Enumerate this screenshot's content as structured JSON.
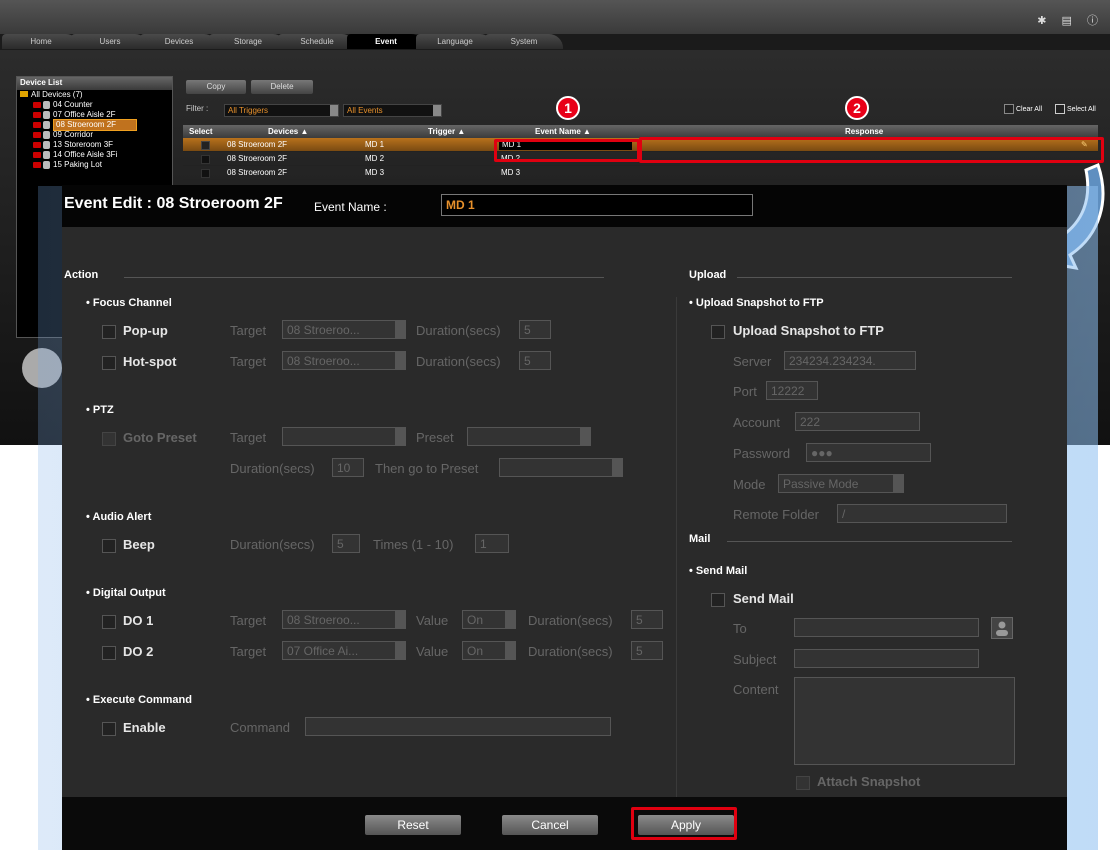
{
  "tabs": [
    "Home",
    "Users",
    "Devices",
    "Storage",
    "Schedule",
    "Event",
    "Language",
    "System"
  ],
  "active_tab": "Event",
  "device_list": {
    "title": "Device List",
    "root": "All Devices (7)",
    "items": [
      "04  Counter",
      "07  Office Aisle 2F",
      "08  Stroeroom 2F",
      "09  Corridor",
      "13  Storeroom 3F",
      "14  Office Aisle 3Fi",
      "15  Paking Lot"
    ]
  },
  "toolbar": {
    "copy_label": "Copy",
    "delete_label": "Delete"
  },
  "filter": {
    "label": "Filter :",
    "trigger_value": "All Triggers",
    "event_value": "All Events"
  },
  "clear_all_label": "Clear All",
  "select_all_label": "Select All",
  "grid": {
    "headers": [
      "Select",
      "Devices ▲",
      "Trigger ▲",
      "Event Name ▲",
      "Response"
    ],
    "rows": [
      {
        "device": "08 Stroeroom 2F",
        "trigger": "MD 1",
        "event": "MD 1"
      },
      {
        "device": "08 Stroeroom 2F",
        "trigger": "MD 2",
        "event": "MD 2"
      },
      {
        "device": "08 Stroeroom 2F",
        "trigger": "MD 3",
        "event": "MD 3"
      }
    ]
  },
  "badges": [
    "1",
    "2"
  ],
  "dialog": {
    "title": "Event Edit : 08 Stroeroom 2F",
    "event_name_label": "Event Name :",
    "event_name_value": "MD 1",
    "action_title": "Action",
    "upload_title": "Upload",
    "mail_title": "Mail",
    "focus": {
      "title": "Focus Channel",
      "popup": "Pop-up",
      "hotspot": "Hot-spot",
      "target": "Target",
      "target_value": "08 Stroeroo...",
      "duration": "Duration(secs)",
      "duration_value": "5"
    },
    "ptz": {
      "title": "PTZ",
      "goto": "Goto Preset",
      "target": "Target",
      "preset": "Preset",
      "duration": "Duration(secs)",
      "duration_value": "10",
      "then": "Then go to Preset"
    },
    "audio": {
      "title": "Audio Alert",
      "beep": "Beep",
      "duration": "Duration(secs)",
      "duration_value": "5",
      "times": "Times (1 - 10)",
      "times_value": "1"
    },
    "dout": {
      "title": "Digital Output",
      "do1": "DO 1",
      "do2": "DO 2",
      "target": "Target",
      "do1_target": "08 Stroeroo...",
      "do2_target": "07 Office Ai...",
      "value": "Value",
      "value_value": "On",
      "duration": "Duration(secs)",
      "duration_value": "5"
    },
    "exec": {
      "title": "Execute Command",
      "enable": "Enable",
      "command": "Command"
    },
    "ftp": {
      "title": "Upload Snapshot to FTP",
      "check": "Upload Snapshot to FTP",
      "server": "Server",
      "server_value": "234234.234234.",
      "port": "Port",
      "port_value": "12222",
      "account": "Account",
      "account_value": "222",
      "password": "Password",
      "password_value": "●●●",
      "mode": "Mode",
      "mode_value": "Passive Mode",
      "folder": "Remote Folder",
      "folder_value": "/"
    },
    "mail": {
      "title": "Send Mail",
      "check": "Send Mail",
      "to": "To",
      "subject": "Subject",
      "content": "Content",
      "attach": "Attach Snapshot"
    },
    "buttons": {
      "reset": "Reset",
      "cancel": "Cancel",
      "apply": "Apply"
    }
  },
  "colors": {
    "accent": "#e8912b",
    "highlight": "#e00010"
  }
}
